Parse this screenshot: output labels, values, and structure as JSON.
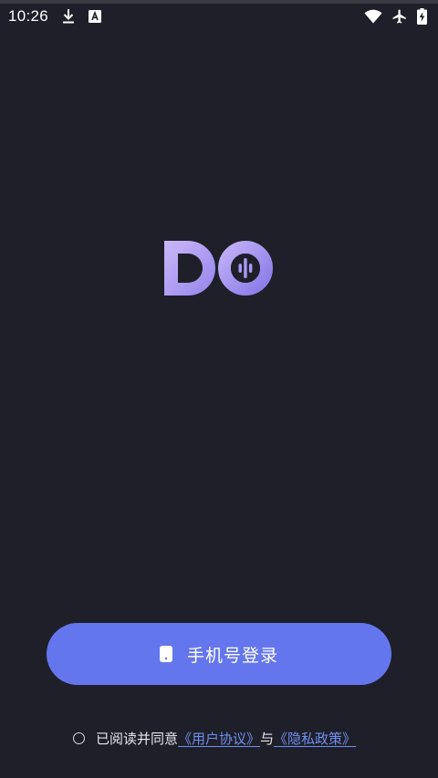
{
  "status_bar": {
    "time": "10:26",
    "icons": [
      "download-icon",
      "text-a-icon",
      "wifi-icon",
      "airplane-mode-icon",
      "battery-charging-icon"
    ]
  },
  "login": {
    "button_label": "手机号登录",
    "button_icon": "phone-icon",
    "button_color": "#6476ed"
  },
  "agreement": {
    "prefix": "已阅读并同意",
    "user_agreement": "《用户协议》",
    "conjunction": "与",
    "privacy_policy": "《隐私政策》"
  },
  "colors": {
    "background": "#1f1f29",
    "link": "#6f8ff0",
    "logo_gradient_start": "#cbb8f8",
    "logo_gradient_end": "#8f80ea"
  }
}
